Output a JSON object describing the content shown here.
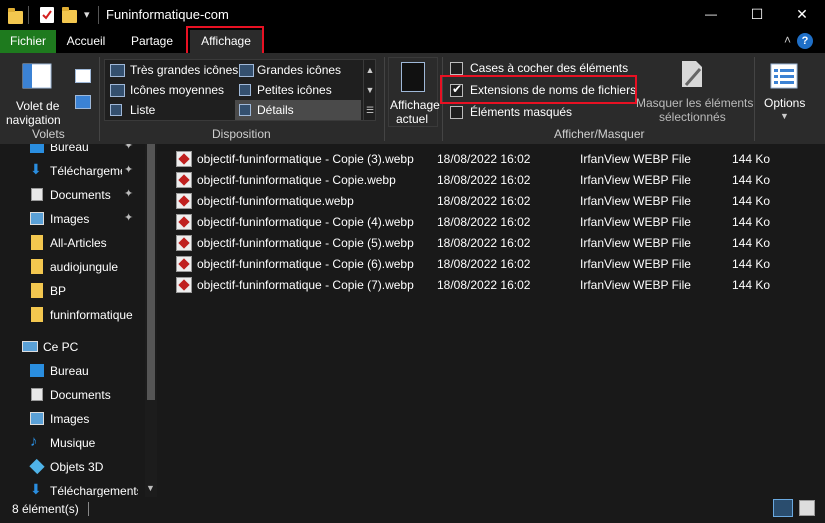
{
  "window": {
    "title": "Funinformatique-com",
    "minimize_glyph": "—",
    "maximize_glyph": "☐",
    "close_glyph": "✕",
    "dropdown_glyph": "▾"
  },
  "tabs": [
    {
      "label": "Fichier"
    },
    {
      "label": "Accueil"
    },
    {
      "label": "Partage"
    },
    {
      "label": "Affichage"
    }
  ],
  "ribbon_right": {
    "collapse_glyph": "˄",
    "help_glyph": "?"
  },
  "ribbon": {
    "volets": {
      "nav_pane_label_1": "Volet de",
      "nav_pane_label_2": "navigation",
      "group_label": "Volets"
    },
    "disposition": {
      "items": [
        {
          "label": "Très grandes icônes"
        },
        {
          "label": "Grandes icônes"
        },
        {
          "label": "Icônes moyennes"
        },
        {
          "label": "Petites icônes"
        },
        {
          "label": "Liste"
        },
        {
          "label": "Détails"
        }
      ],
      "group_label": "Disposition"
    },
    "affichage_actuel": {
      "label_1": "Affichage",
      "label_2": "actuel"
    },
    "afficher_masquer": {
      "checkboxes": [
        {
          "label": "Cases à cocher des éléments",
          "checked": false
        },
        {
          "label": "Extensions de noms de fichiers",
          "checked": true
        },
        {
          "label": "Éléments masqués",
          "checked": false
        }
      ],
      "hide_selected_1": "Masquer les éléments",
      "hide_selected_2": "sélectionnés",
      "group_label": "Afficher/Masquer"
    },
    "options": {
      "label": "Options"
    }
  },
  "nav": {
    "quick_access": [
      {
        "label": "Bureau",
        "pinned": true
      },
      {
        "label": "Téléchargements",
        "pinned": true
      },
      {
        "label": "Documents",
        "pinned": true
      },
      {
        "label": "Images",
        "pinned": true
      },
      {
        "label": "All-Articles"
      },
      {
        "label": "audiojungule"
      },
      {
        "label": "BP"
      },
      {
        "label": "funinformatique"
      }
    ],
    "pc": {
      "label": "Ce PC"
    },
    "pc_items": [
      {
        "label": "Bureau"
      },
      {
        "label": "Documents"
      },
      {
        "label": "Images"
      },
      {
        "label": "Musique"
      },
      {
        "label": "Objets 3D"
      },
      {
        "label": "Téléchargements"
      }
    ]
  },
  "files": [
    {
      "name": "objectif-funinformatique - Copie (3).webp",
      "date": "18/08/2022 16:02",
      "type": "IrfanView WEBP File",
      "size": "144 Ko"
    },
    {
      "name": "objectif-funinformatique - Copie.webp",
      "date": "18/08/2022 16:02",
      "type": "IrfanView WEBP File",
      "size": "144 Ko"
    },
    {
      "name": "objectif-funinformatique.webp",
      "date": "18/08/2022 16:02",
      "type": "IrfanView WEBP File",
      "size": "144 Ko"
    },
    {
      "name": "objectif-funinformatique - Copie (4).webp",
      "date": "18/08/2022 16:02",
      "type": "IrfanView WEBP File",
      "size": "144 Ko"
    },
    {
      "name": "objectif-funinformatique - Copie (5).webp",
      "date": "18/08/2022 16:02",
      "type": "IrfanView WEBP File",
      "size": "144 Ko"
    },
    {
      "name": "objectif-funinformatique - Copie (6).webp",
      "date": "18/08/2022 16:02",
      "type": "IrfanView WEBP File",
      "size": "144 Ko"
    },
    {
      "name": "objectif-funinformatique - Copie (7).webp",
      "date": "18/08/2022 16:02",
      "type": "IrfanView WEBP File",
      "size": "144 Ko"
    }
  ],
  "status": {
    "count": "8 élément(s)"
  },
  "colors": {
    "highlight": "#e81123",
    "file_tab": "#1e7a1e",
    "folder": "#f3c74f"
  }
}
